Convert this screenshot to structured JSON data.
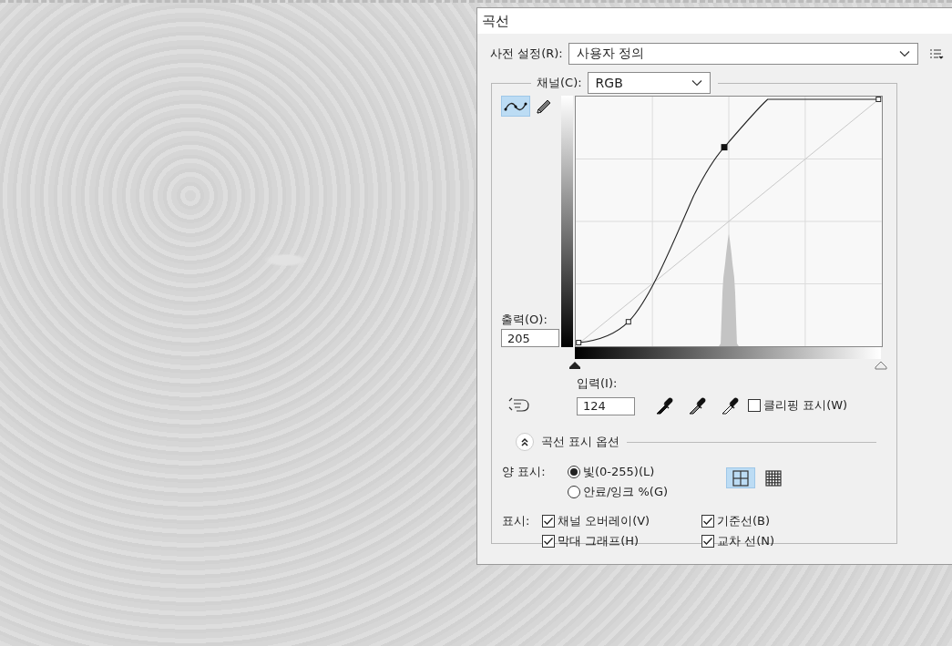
{
  "window": {
    "title": "곡선"
  },
  "preset": {
    "label": "사전 설정(R):",
    "value": "사용자 정의"
  },
  "channel": {
    "label": "채널(C):",
    "value": "RGB"
  },
  "tools": [
    {
      "kind": "curve",
      "selected": true
    },
    {
      "kind": "pencil",
      "selected": false
    }
  ],
  "curve_points": [
    {
      "selected": false
    },
    {
      "selected": false
    },
    {
      "selected": true
    },
    {
      "selected": false
    }
  ],
  "input_sliders": [
    {
      "kind": "shadow",
      "level": 0
    },
    {
      "kind": "highlight",
      "level": 1
    }
  ],
  "output": {
    "label": "출력(O):",
    "value": "205"
  },
  "input": {
    "label": "입력(I):",
    "value": "124"
  },
  "clipping": {
    "label": "클리핑 표시(W)",
    "checked": false
  },
  "curve_options": {
    "title": "곡선 표시 옵션",
    "expanded": true
  },
  "amount": {
    "label": "양 표시:",
    "options": [
      {
        "label": "빛(0-255)(L)",
        "selected": true
      },
      {
        "label": "안료/잉크 %(G)",
        "selected": false
      }
    ]
  },
  "grid_options": [
    {
      "kind": "simple",
      "selected": true
    },
    {
      "kind": "detailed",
      "selected": false
    }
  ],
  "show": {
    "label": "표시:",
    "options": [
      {
        "label": "채널 오버레이(V)",
        "checked": true
      },
      {
        "label": "기준선(B)",
        "checked": true
      },
      {
        "label": "막대 그래프(H)",
        "checked": true
      },
      {
        "label": "교차 선(N)",
        "checked": true
      }
    ]
  }
}
